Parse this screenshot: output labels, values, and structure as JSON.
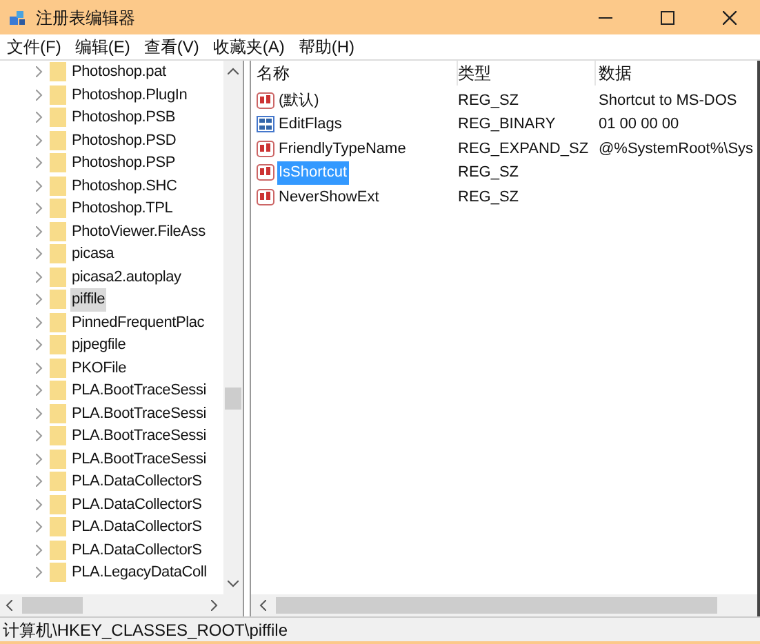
{
  "window": {
    "title": "注册表编辑器"
  },
  "menu": [
    "文件(F)",
    "编辑(E)",
    "查看(V)",
    "收藏夹(A)",
    "帮助(H)"
  ],
  "tree": {
    "items": [
      {
        "label": "Photoshop.pat",
        "selected": false
      },
      {
        "label": "Photoshop.PlugIn",
        "selected": false
      },
      {
        "label": "Photoshop.PSB",
        "selected": false
      },
      {
        "label": "Photoshop.PSD",
        "selected": false
      },
      {
        "label": "Photoshop.PSP",
        "selected": false
      },
      {
        "label": "Photoshop.SHC",
        "selected": false
      },
      {
        "label": "Photoshop.TPL",
        "selected": false
      },
      {
        "label": "PhotoViewer.FileAss",
        "selected": false
      },
      {
        "label": "picasa",
        "selected": false
      },
      {
        "label": "picasa2.autoplay",
        "selected": false
      },
      {
        "label": "piffile",
        "selected": true
      },
      {
        "label": "PinnedFrequentPlac",
        "selected": false
      },
      {
        "label": "pjpegfile",
        "selected": false
      },
      {
        "label": "PKOFile",
        "selected": false
      },
      {
        "label": "PLA.BootTraceSessi",
        "selected": false
      },
      {
        "label": "PLA.BootTraceSessi",
        "selected": false
      },
      {
        "label": "PLA.BootTraceSessi",
        "selected": false
      },
      {
        "label": "PLA.BootTraceSessi",
        "selected": false
      },
      {
        "label": "PLA.DataCollectorS",
        "selected": false
      },
      {
        "label": "PLA.DataCollectorS",
        "selected": false
      },
      {
        "label": "PLA.DataCollectorS",
        "selected": false
      },
      {
        "label": "PLA.DataCollectorS",
        "selected": false
      },
      {
        "label": "PLA.LegacyDataColl",
        "selected": false
      }
    ]
  },
  "values": {
    "columns": [
      "名称",
      "类型",
      "数据"
    ],
    "rows": [
      {
        "kind": "string",
        "name": "(默认)",
        "type": "REG_SZ",
        "data": "Shortcut to MS-DOS",
        "selected": false
      },
      {
        "kind": "binary",
        "name": "EditFlags",
        "type": "REG_BINARY",
        "data": "01 00 00 00",
        "selected": false
      },
      {
        "kind": "string",
        "name": "FriendlyTypeName",
        "type": "REG_EXPAND_SZ",
        "data": "@%SystemRoot%\\Sys",
        "selected": false
      },
      {
        "kind": "string",
        "name": "IsShortcut",
        "type": "REG_SZ",
        "selected": true
      },
      {
        "kind": "string",
        "name": "NeverShowExt",
        "type": "REG_SZ",
        "selected": false
      }
    ]
  },
  "status_bar": "计算机\\HKEY_CLASSES_ROOT\\piffile"
}
